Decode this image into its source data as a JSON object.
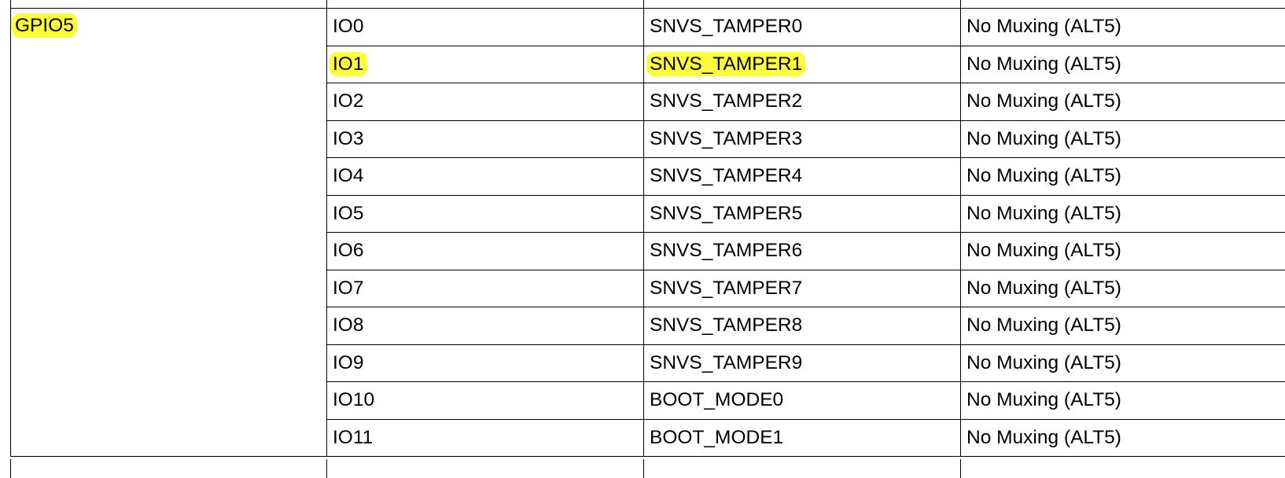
{
  "table": {
    "group": "GPIO5",
    "highlight_color": "#fdfd3a",
    "rows": [
      {
        "io": "IO0",
        "pad": "SNVS_TAMPER0",
        "mux": "No Muxing (ALT5)",
        "highlight": false
      },
      {
        "io": "IO1",
        "pad": "SNVS_TAMPER1",
        "mux": "No Muxing (ALT5)",
        "highlight": true
      },
      {
        "io": "IO2",
        "pad": "SNVS_TAMPER2",
        "mux": "No Muxing (ALT5)",
        "highlight": false
      },
      {
        "io": "IO3",
        "pad": "SNVS_TAMPER3",
        "mux": "No Muxing (ALT5)",
        "highlight": false
      },
      {
        "io": "IO4",
        "pad": "SNVS_TAMPER4",
        "mux": "No Muxing (ALT5)",
        "highlight": false
      },
      {
        "io": "IO5",
        "pad": "SNVS_TAMPER5",
        "mux": "No Muxing (ALT5)",
        "highlight": false
      },
      {
        "io": "IO6",
        "pad": "SNVS_TAMPER6",
        "mux": "No Muxing (ALT5)",
        "highlight": false
      },
      {
        "io": "IO7",
        "pad": "SNVS_TAMPER7",
        "mux": "No Muxing (ALT5)",
        "highlight": false
      },
      {
        "io": "IO8",
        "pad": "SNVS_TAMPER8",
        "mux": "No Muxing (ALT5)",
        "highlight": false
      },
      {
        "io": "IO9",
        "pad": "SNVS_TAMPER9",
        "mux": "No Muxing (ALT5)",
        "highlight": false
      },
      {
        "io": "IO10",
        "pad": "BOOT_MODE0",
        "mux": "No Muxing (ALT5)",
        "highlight": false
      },
      {
        "io": "IO11",
        "pad": "BOOT_MODE1",
        "mux": "No Muxing (ALT5)",
        "highlight": false
      }
    ]
  }
}
